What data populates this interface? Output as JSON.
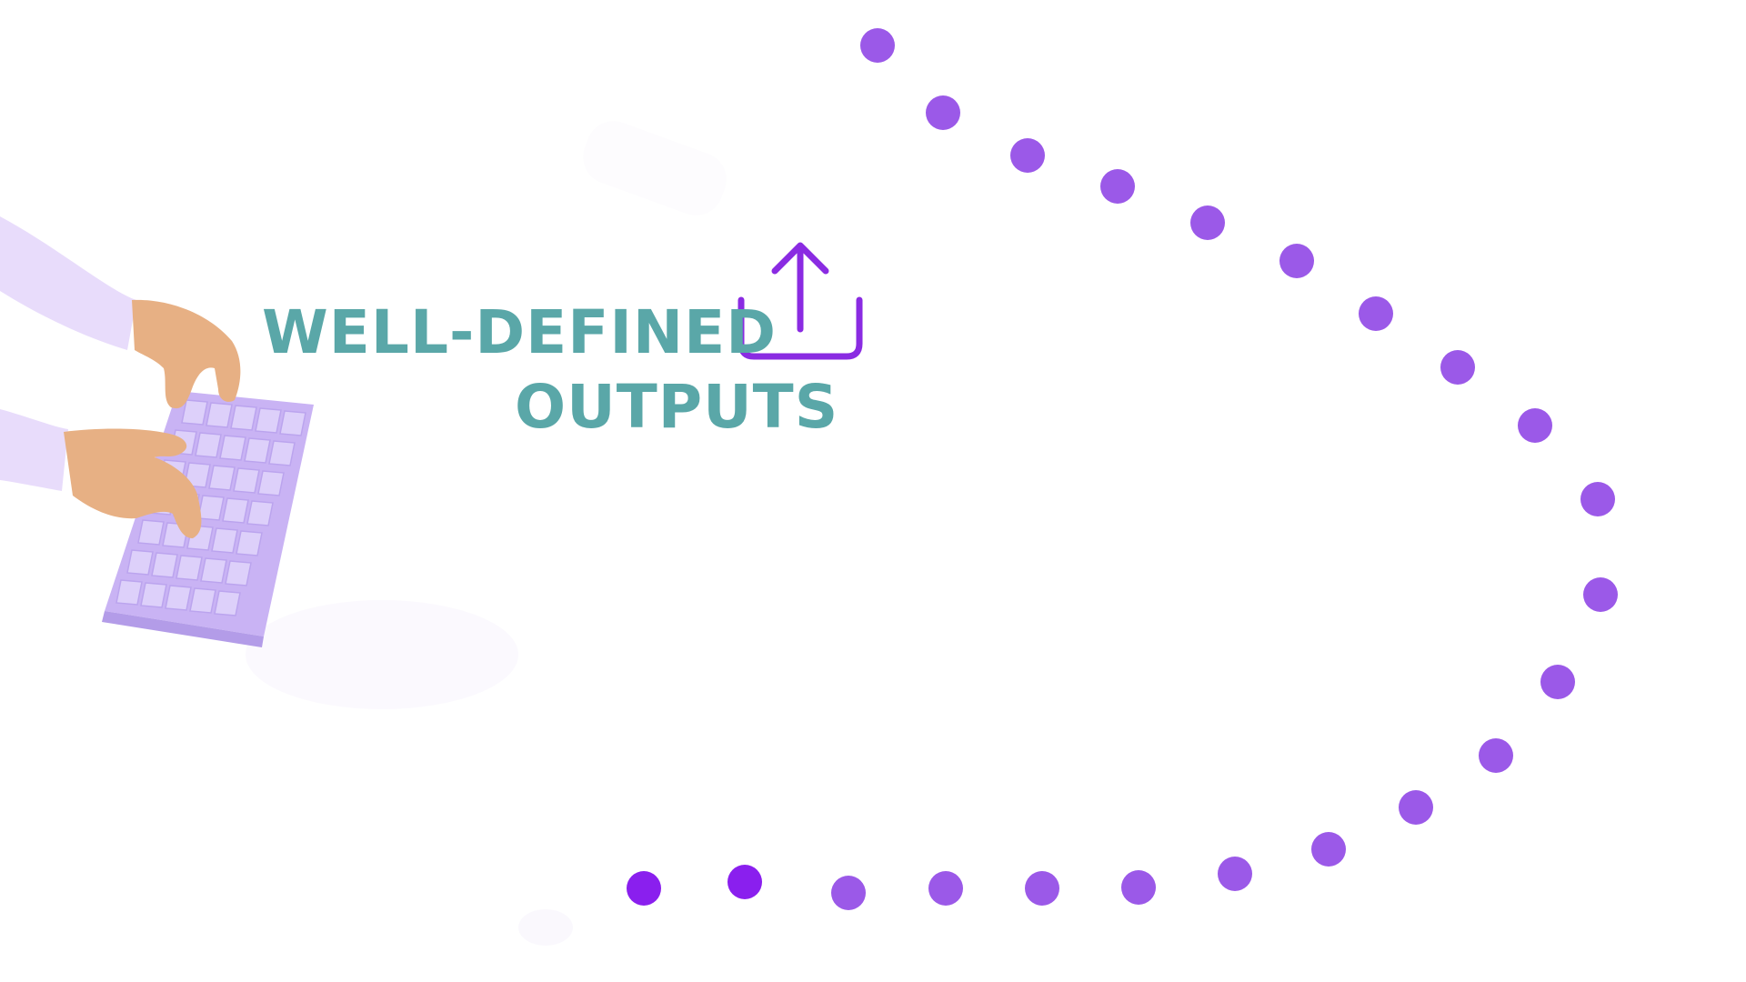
{
  "title": {
    "line1": "WELL-DEFINED",
    "line2": "OUTPUTS"
  },
  "icons": {
    "upload": "upload-icon",
    "illustration": "hands-typing-keyboard-illustration"
  },
  "colors": {
    "title_text": "#5aa7a8",
    "icon_stroke": "#8a2be2",
    "dot": "#9b59e8",
    "dot_dark": "#8a1fee",
    "keyboard": "#cdb8f6",
    "sleeve": "#e8dcfb",
    "skin": "#e7b084"
  }
}
